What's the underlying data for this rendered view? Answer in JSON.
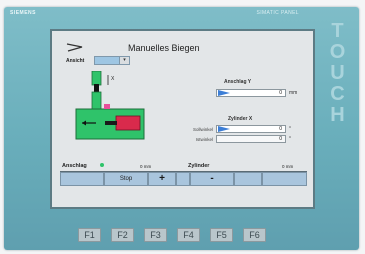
{
  "device": {
    "brand": "SIEMENS",
    "brand_right": "SIMATIC PANEL",
    "touch_label": [
      "T",
      "O",
      "U",
      "C",
      "H"
    ]
  },
  "screen": {
    "title": "Manuelles Biegen",
    "ansicht_label": "Ansicht",
    "anschlag": {
      "label": "Anschlag Y",
      "value": "0",
      "unit": "mm"
    },
    "zylinder": {
      "label": "Zylinder X",
      "sollwert_label": "Sollwinkel",
      "sollwert_value": "0",
      "istwert_label": "Istwinkel",
      "istwert_value": "0",
      "unit": "°"
    },
    "status": {
      "anschlag_label": "Anschlag",
      "anschlag_unit": "0 mm",
      "zylinder_label": "Zylinder",
      "zylinder_unit": "0 mm"
    },
    "buttons": {
      "stop": "Stop",
      "plus": "+",
      "minus": "-"
    }
  },
  "function_keys": [
    "F1",
    "F2",
    "F3",
    "F4",
    "F5",
    "F6"
  ],
  "colors": {
    "bezel": "#69aebb",
    "screen_bg": "#e3e6e8",
    "machine_green": "#2fc36a",
    "machine_red": "#d92a4c",
    "accent_blue": "#3c7ed6",
    "button_blue": "#a9c5dd"
  }
}
